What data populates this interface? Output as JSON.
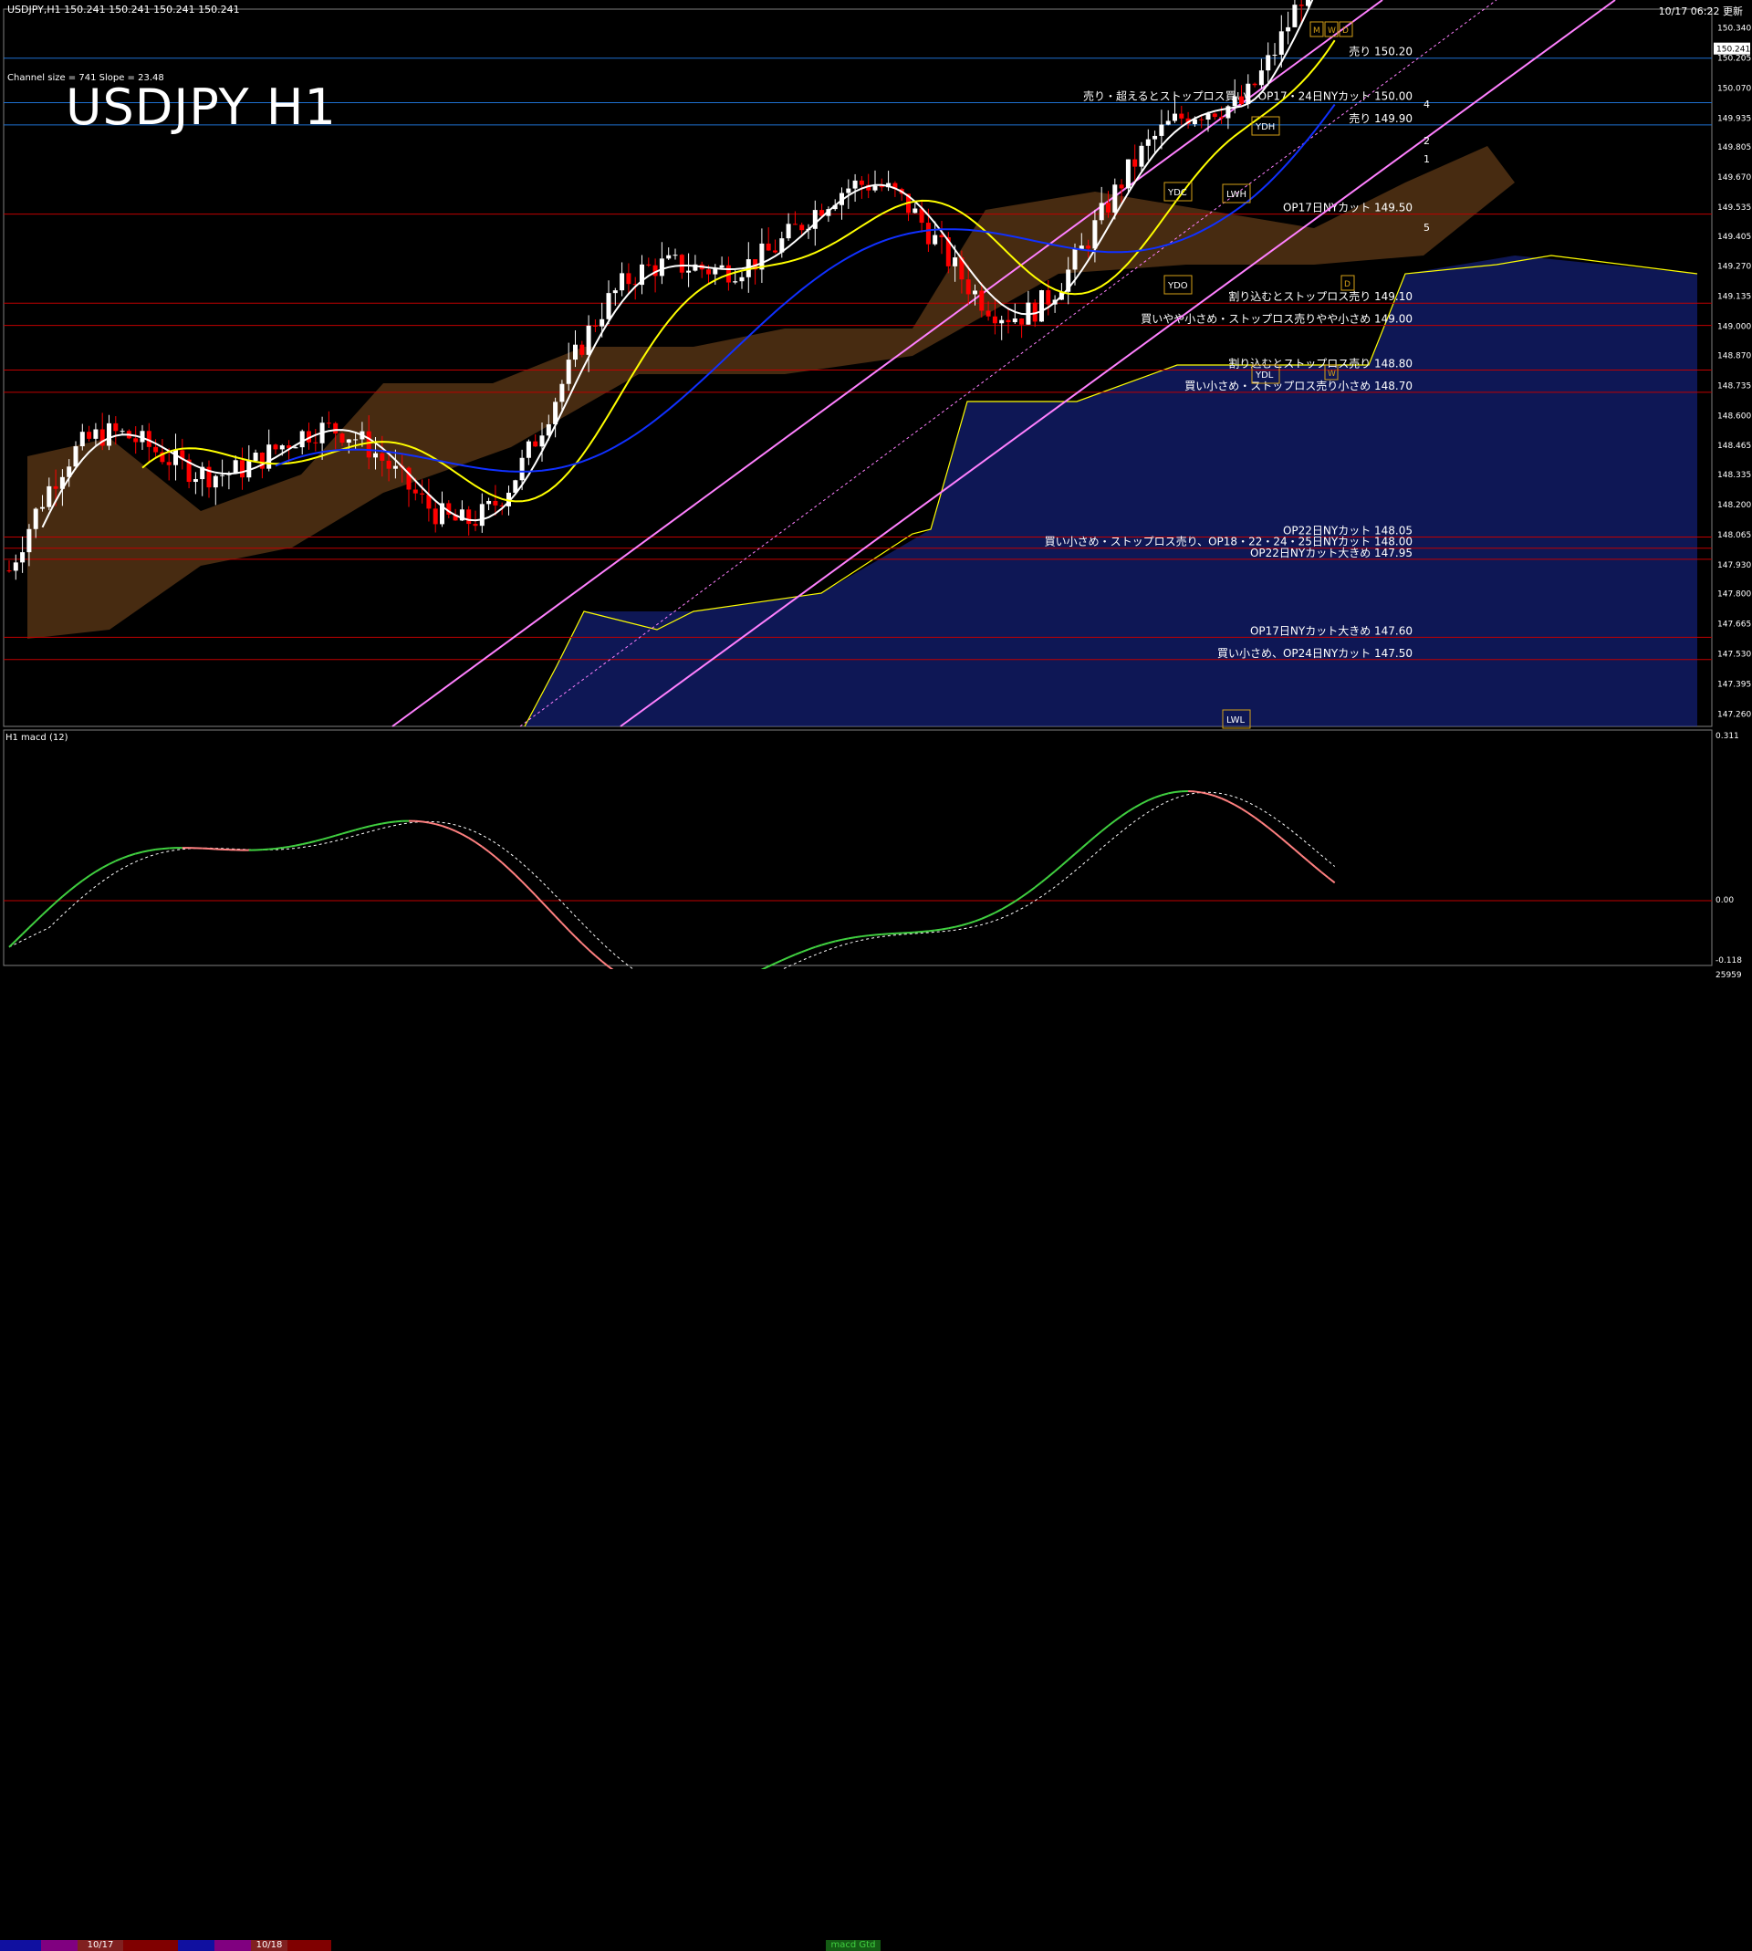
{
  "header": {
    "symbol_info": "USDJPY,H1  150.241 150.241 150.241 150.241",
    "timestamp": "10/17 06:22 更新",
    "channel_info": "Channel size = 741 Slope = 23.48",
    "big_title": "USDJPY H1"
  },
  "sub_panel": {
    "label": "H1  macd (12)",
    "axis": [
      "0.311",
      "0.00",
      "-0.118"
    ],
    "bottom_value": "25959"
  },
  "bottom_bar": {
    "labels": [
      "10/17",
      "10/18"
    ],
    "center_label": "macd Gtd"
  },
  "chart_data": {
    "type": "candlestick",
    "title": "USDJPY H1",
    "price_axis": [
      "150.340",
      "150.205",
      "150.070",
      "149.935",
      "149.805",
      "149.670",
      "149.535",
      "149.405",
      "149.270",
      "149.135",
      "149.000",
      "148.870",
      "148.735",
      "148.600",
      "148.465",
      "148.335",
      "148.200",
      "148.065",
      "147.930",
      "147.800",
      "147.665",
      "147.530",
      "147.395",
      "147.260"
    ],
    "current_price_tag": "150.241",
    "ylim": [
      147.2,
      150.42
    ],
    "annotations": [
      {
        "text": "売り 150.20",
        "price": 150.2
      },
      {
        "text": "売り・超えるとストップロス買い、OP17・24日NYカット 150.00",
        "price": 150.0
      },
      {
        "text": "売り 149.90",
        "price": 149.9
      },
      {
        "text": "OP17日NYカット 149.50",
        "price": 149.5
      },
      {
        "text": "割り込むとストップロス売り 149.10",
        "price": 149.1
      },
      {
        "text": "買いやや小さめ・ストップロス売りやや小さめ 149.00",
        "price": 149.0
      },
      {
        "text": "割り込むとストップロス売り 148.80",
        "price": 148.8
      },
      {
        "text": "買い小さめ・ストップロス売り小さめ 148.70",
        "price": 148.7
      },
      {
        "text": "OP22日NYカット 148.05",
        "price": 148.05
      },
      {
        "text": "買い小さめ・ストップロス売り、OP18・22・24・25日NYカット 148.00",
        "price": 148.0
      },
      {
        "text": "OP22日NYカット大きめ 147.95",
        "price": 147.95
      },
      {
        "text": "OP17日NYカット大きめ 147.60",
        "price": 147.6
      },
      {
        "text": "買い小さめ、OP24日NYカット 147.50",
        "price": 147.5
      }
    ],
    "channel_labels": [
      "4",
      "2",
      "1",
      "5"
    ],
    "level_boxes": [
      "YDH",
      "YDC",
      "LWH",
      "YDO",
      "YDL",
      "LWL",
      "D",
      "M",
      "W",
      "D",
      "W"
    ]
  },
  "colors": {
    "background": "#000000",
    "bull": "#ffffff",
    "bear": "#ff0000",
    "hline_red": "#c00000",
    "hline_blue": "#1e6fd0",
    "channel": "#ff80ff",
    "ma_white": "#ffffff",
    "ma_yellow": "#ffff00",
    "ma_blue": "#1030ff",
    "lagging": "#00cc00",
    "cloud_blue": "#1a2a9a",
    "cloud_orange": "#cc7a30",
    "macd_up": "#40d040",
    "macd_down": "#ff8080",
    "label_gold": "#d4a017"
  }
}
